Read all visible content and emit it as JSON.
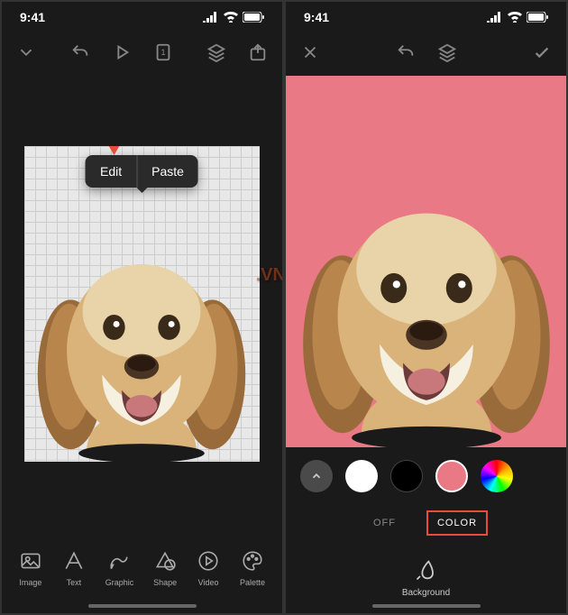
{
  "status": {
    "time": "9:41"
  },
  "left": {
    "popup": {
      "edit": "Edit",
      "paste": "Paste"
    },
    "tools": {
      "image": "Image",
      "text": "Text",
      "graphic": "Graphic",
      "shape": "Shape",
      "video": "Video",
      "palette": "Palette"
    }
  },
  "right": {
    "tabs": {
      "off": "OFF",
      "color": "COLOR"
    },
    "tool": {
      "background": "Background"
    },
    "colors": {
      "pink": "#e87985",
      "white": "#ffffff",
      "black": "#000000"
    }
  },
  "watermark": ".VN"
}
